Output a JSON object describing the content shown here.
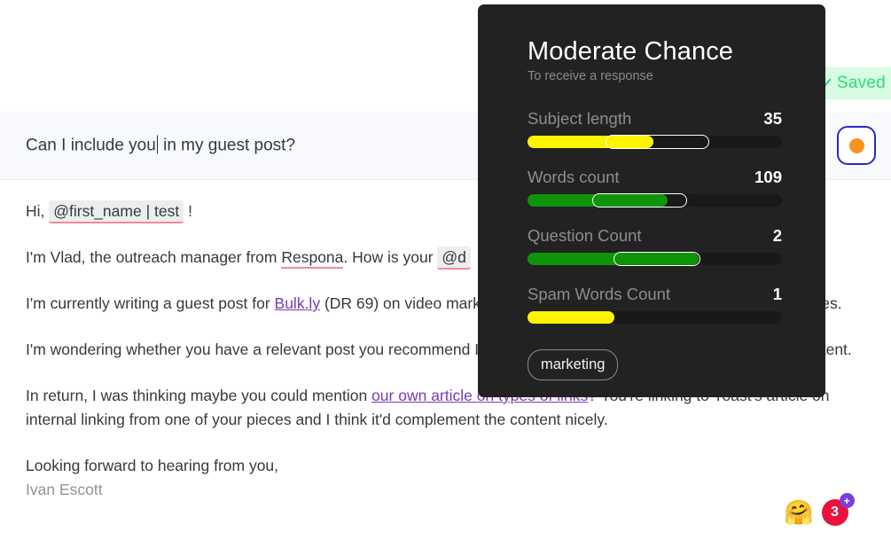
{
  "saved_toast": {
    "label": "Saved",
    "icon": "check-icon",
    "text_color": "#2fdc76",
    "background": "#d7fbe3"
  },
  "subject": {
    "value_before_caret": "Can I include you",
    "value_after_caret": " in my guest post?",
    "full_value": "Can I include you in my guest post?"
  },
  "accent_button": {
    "icon": "orange-dot-icon",
    "border_color": "#2b28c4",
    "dot_color": "#f79420"
  },
  "email_body": {
    "greeting_prefix": "Hi, ",
    "greeting_tag": "@first_name | test",
    "greeting_suffix": " !",
    "paragraph2_part1": "I'm Vlad, the outreach manager from ",
    "paragraph2_misspelled": "Respona",
    "paragraph2_part2": ". How is your ",
    "paragraph2_tag": "@d",
    "paragraph3_part1": "I'm currently writing a guest post for ",
    "paragraph3_link": "Bulk.ly",
    "paragraph3_part2": " (DR 69) on video marketing, and I was hoping to link to one of your articles.",
    "paragraph4": "I'm wondering whether you have a relevant post you recommend I check out, or if you'd like to take a look at the content.",
    "paragraph5_part1": "In return, I was thinking maybe you could mention ",
    "paragraph5_link": "our own article on types of links",
    "paragraph5_part2": "? You're linking to Yoast's article on internal linking from one of your pieces and I think it'd complement the content nicely.",
    "closing": "Looking forward to hearing from you,",
    "signature": "Ivan Escott"
  },
  "widgets": {
    "emoji": "🤗",
    "emoji_name": "hugging-face-emoji",
    "count": "3",
    "plus": "+"
  },
  "chance_panel": {
    "title": "Moderate Chance",
    "subtitle": "To receive a response",
    "background": "#222222",
    "metrics": [
      {
        "label": "Subject length",
        "value": "35",
        "fill_color": "#fdf500",
        "fill_percent": 49.5,
        "zone_start_percent": 30.7,
        "zone_end_percent": 71.4
      },
      {
        "label": "Words count",
        "value": "109",
        "fill_color": "#0e9409",
        "fill_percent": 55.0,
        "zone_start_percent": 25.4,
        "zone_end_percent": 62.7
      },
      {
        "label": "Question Count",
        "value": "2",
        "fill_color": "#0e9409",
        "fill_percent": 67.3,
        "zone_start_percent": 33.8,
        "zone_end_percent": 68.0
      },
      {
        "label": "Spam Words Count",
        "value": "1",
        "fill_color": "#fdf500",
        "fill_percent": 34.2,
        "zone_start_percent": null,
        "zone_end_percent": null
      }
    ],
    "tag": "marketing"
  }
}
